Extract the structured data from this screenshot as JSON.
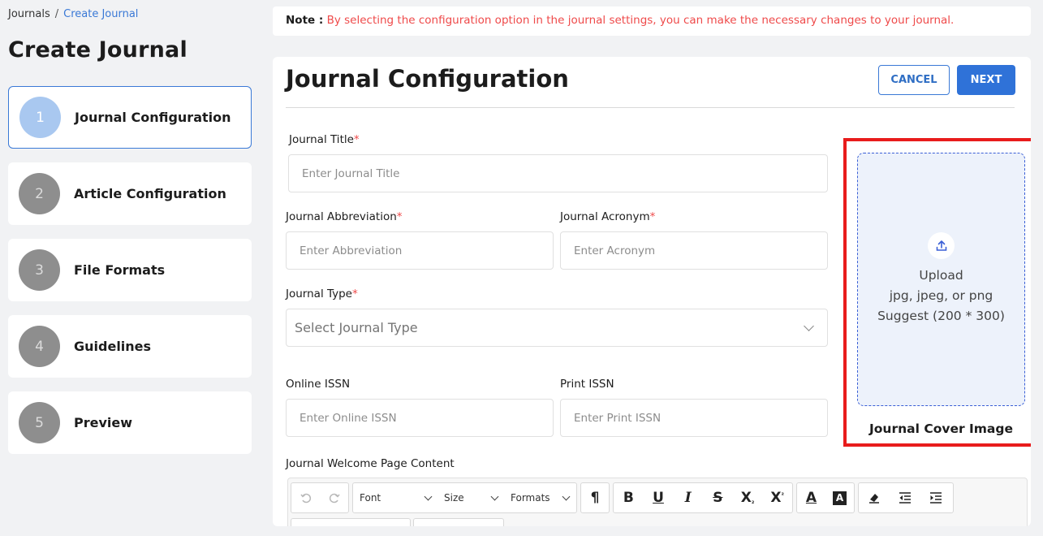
{
  "breadcrumb": {
    "root": "Journals",
    "separator": "/",
    "current": "Create Journal"
  },
  "page_title": "Create Journal",
  "steps": [
    {
      "number": "1",
      "label": "Journal Configuration",
      "active": true
    },
    {
      "number": "2",
      "label": "Article Configuration",
      "active": false
    },
    {
      "number": "3",
      "label": "File Formats",
      "active": false
    },
    {
      "number": "4",
      "label": "Guidelines",
      "active": false
    },
    {
      "number": "5",
      "label": "Preview",
      "active": false
    }
  ],
  "note": {
    "label": "Note :",
    "text": "By selecting the configuration option in the journal settings, you can make the necessary changes to your journal."
  },
  "form": {
    "title": "Journal Configuration",
    "cancel_label": "CANCEL",
    "next_label": "NEXT",
    "required_mark": "*",
    "journal_title": {
      "label": "Journal Title",
      "placeholder": "Enter Journal Title"
    },
    "abbreviation": {
      "label": "Journal Abbreviation",
      "placeholder": "Enter Abbreviation"
    },
    "acronym": {
      "label": "Journal Acronym",
      "placeholder": "Enter Acronym"
    },
    "journal_type": {
      "label": "Journal Type",
      "placeholder": "Select Journal Type"
    },
    "online_issn": {
      "label": "Online ISSN",
      "placeholder": "Enter Online ISSN"
    },
    "print_issn": {
      "label": "Print ISSN",
      "placeholder": "Enter Print ISSN"
    },
    "welcome_content": {
      "label": "Journal Welcome Page Content"
    }
  },
  "upload": {
    "title": "Upload",
    "formats": "jpg, jpeg, or png",
    "suggest": "Suggest (200 * 300)",
    "caption": "Journal Cover Image",
    "highlight_color": "#e81c1c"
  },
  "editor_toolbar": {
    "font_label": "Font",
    "size_label": "Size",
    "formats_label": "Formats",
    "icons": [
      "undo-icon",
      "redo-icon",
      "paragraph-icon",
      "bold-icon",
      "underline-icon",
      "italic-icon",
      "strikethrough-icon",
      "subscript-icon",
      "superscript-icon",
      "font-color-icon",
      "highlight-color-icon",
      "eraser-icon",
      "outdent-icon",
      "indent-icon"
    ]
  },
  "colors": {
    "accent": "#2f72d8",
    "required": "#ef4a4a",
    "note_text": "#ef4a4a"
  }
}
